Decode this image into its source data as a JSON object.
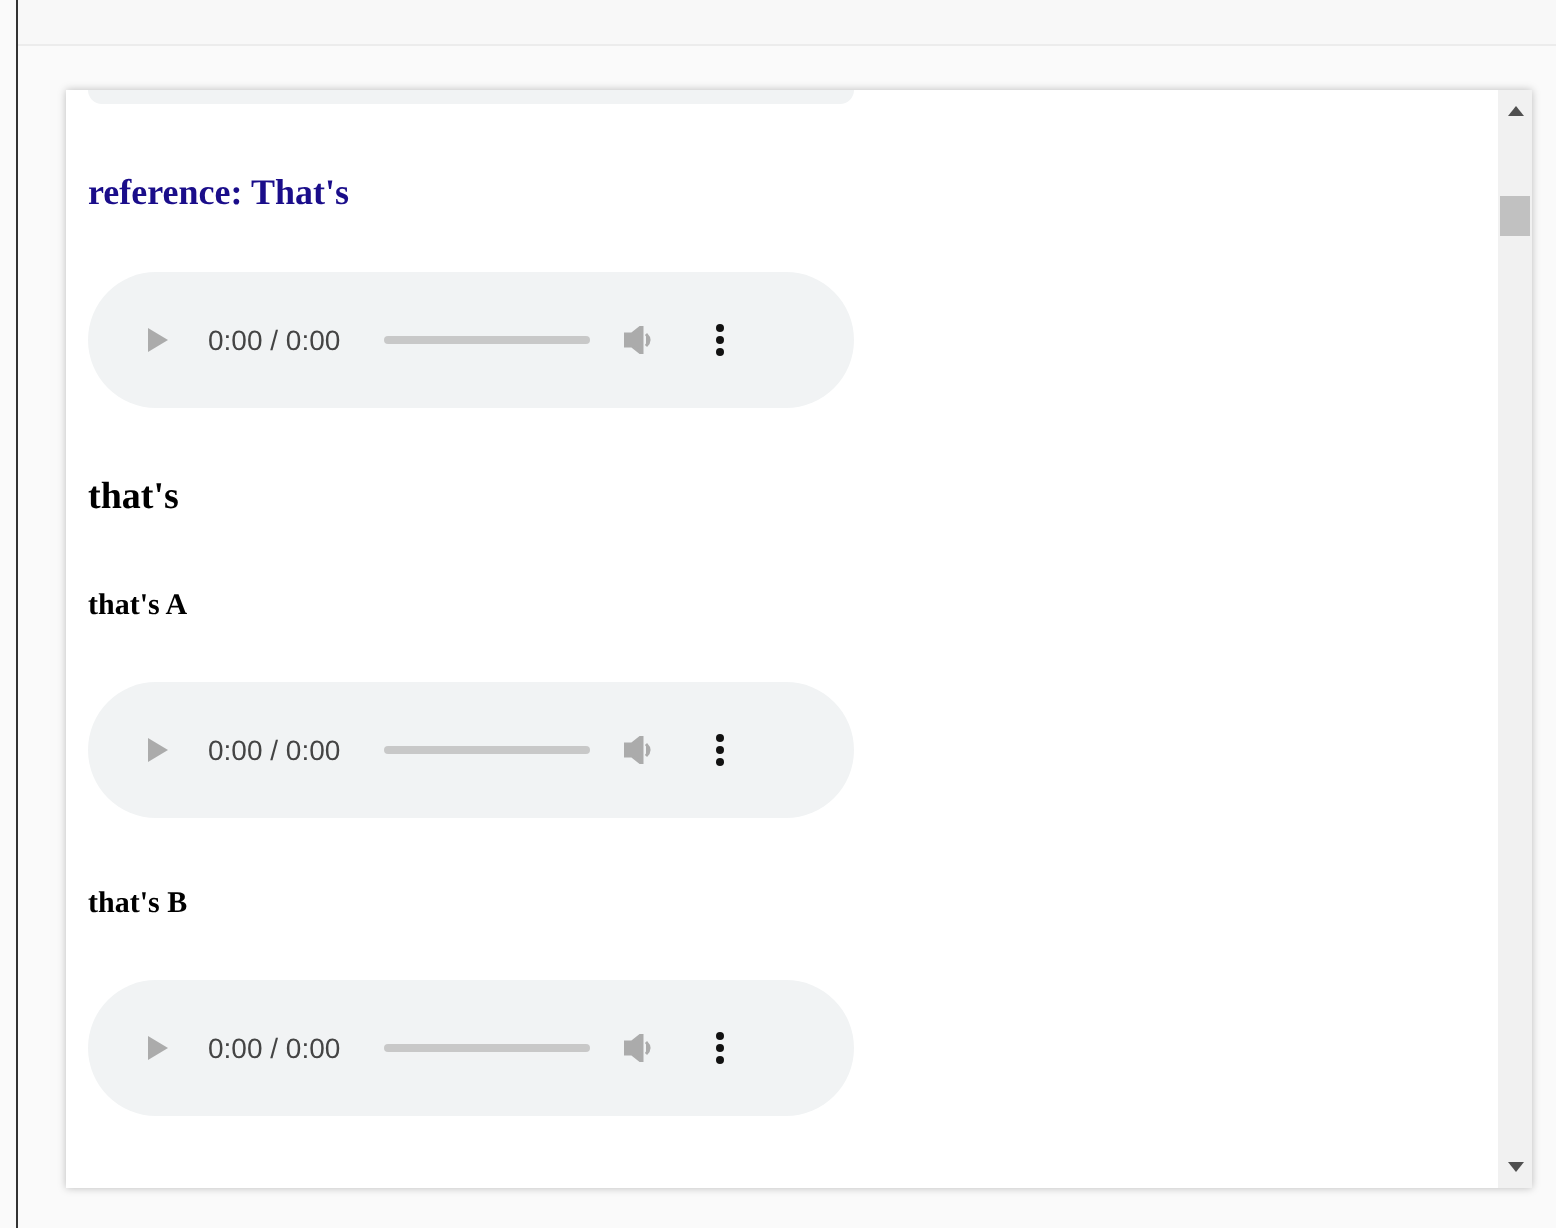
{
  "sections": [
    {
      "kind": "audio_clipped"
    },
    {
      "kind": "link_heading",
      "text": "reference: That's"
    },
    {
      "kind": "audio",
      "time": "0:00 / 0:00",
      "level": 0
    },
    {
      "kind": "heading",
      "text": "that's"
    },
    {
      "kind": "subheading",
      "text": "that's A"
    },
    {
      "kind": "audio",
      "time": "0:00 / 0:00",
      "level": 0
    },
    {
      "kind": "subheading",
      "text": "that's B"
    },
    {
      "kind": "audio",
      "time": "0:00 / 0:00",
      "level": 0
    }
  ]
}
